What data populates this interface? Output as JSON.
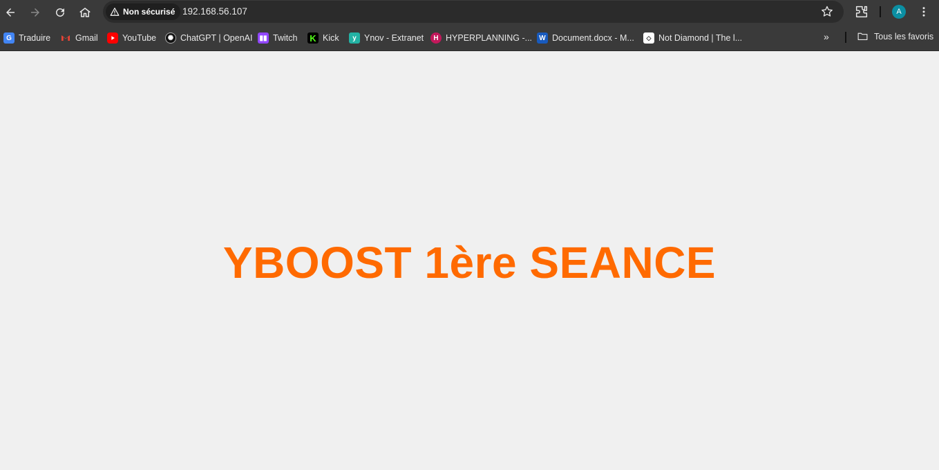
{
  "browser": {
    "security_chip": "Non sécurisé",
    "url": "192.168.56.107",
    "profile_initial": "A"
  },
  "bookmarks": [
    {
      "label": "Traduire",
      "icon": "google-translate-icon",
      "color": "#4285f4"
    },
    {
      "label": "Gmail",
      "icon": "gmail-icon",
      "color": "#ea4335"
    },
    {
      "label": "YouTube",
      "icon": "youtube-icon",
      "color": "#ff0000"
    },
    {
      "label": "ChatGPT | OpenAI",
      "icon": "openai-icon",
      "color": "#000000"
    },
    {
      "label": "Twitch",
      "icon": "twitch-icon",
      "color": "#9146ff"
    },
    {
      "label": "Kick",
      "icon": "kick-icon",
      "color": "#53fc18"
    },
    {
      "label": "Ynov - Extranet",
      "icon": "ynov-icon",
      "color": "#23b2a4"
    },
    {
      "label": "HYPERPLANNING -...",
      "icon": "hyperplanning-icon",
      "color": "#c2185b"
    },
    {
      "label": "Document.docx - M...",
      "icon": "word-icon",
      "color": "#185abd"
    },
    {
      "label": "Not Diamond | The l...",
      "icon": "notdiamond-icon",
      "color": "#ffffff"
    }
  ],
  "all_bookmarks_label": "Tous les favoris",
  "page": {
    "heading": "YBOOST 1ère SEANCE",
    "heading_color": "#ff6a00"
  }
}
